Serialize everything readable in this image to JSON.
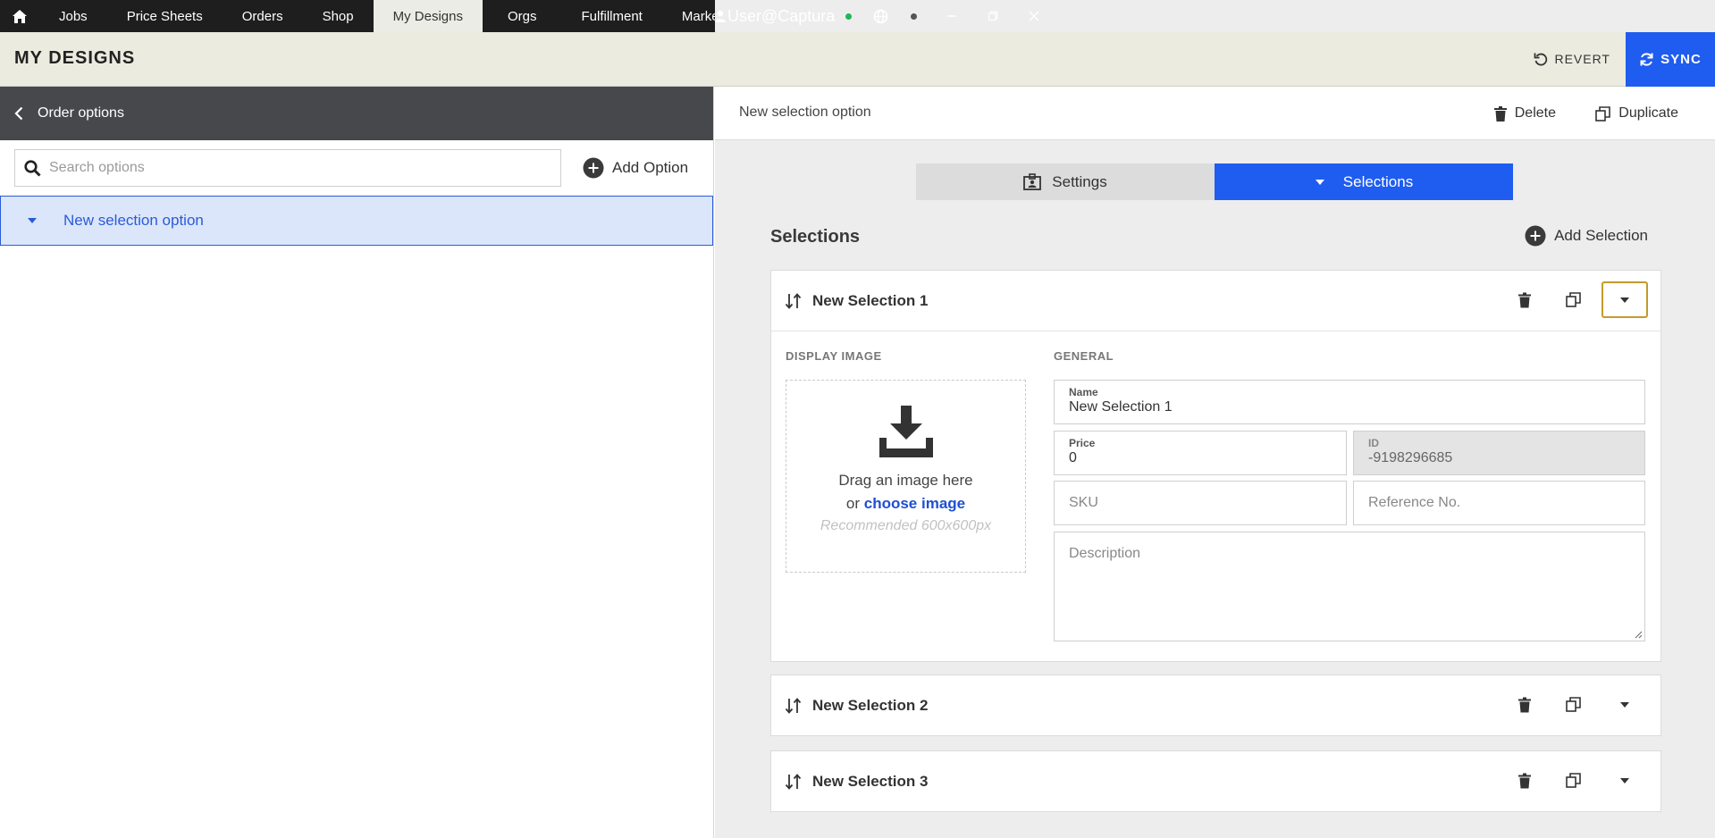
{
  "topnav": {
    "tabs": [
      "Jobs",
      "Price Sheets",
      "Orders",
      "Shop",
      "My Designs",
      "Orgs",
      "Fulfillment",
      "Marketing"
    ],
    "active_tab": "My Designs",
    "user": "User@Captura"
  },
  "header": {
    "title": "MY DESIGNS",
    "revert_label": "REVERT",
    "sync_label": "SYNC"
  },
  "left": {
    "breadcrumb": "Order options",
    "search_placeholder": "Search options",
    "add_option_label": "Add Option",
    "options": [
      {
        "label": "New selection option",
        "selected": true
      }
    ]
  },
  "right": {
    "option_name": "New selection option",
    "delete_label": "Delete",
    "duplicate_label": "Duplicate",
    "tabs": {
      "settings": "Settings",
      "selections": "Selections",
      "active": "Selections"
    },
    "section_title": "Selections",
    "add_selection_label": "Add Selection",
    "display_image_label": "DISPLAY IMAGE",
    "general_label": "GENERAL",
    "drop_text_1": "Drag an image here",
    "drop_text_2_prefix": "or",
    "drop_text_2_link": "choose image",
    "drop_text_3": "Recommended 600x600px",
    "fields": {
      "name_label": "Name",
      "name_value": "New Selection 1",
      "price_label": "Price",
      "price_value": "0",
      "id_label": "ID",
      "id_value": "-9198296685",
      "sku_placeholder": "SKU",
      "reference_placeholder": "Reference No.",
      "description_placeholder": "Description"
    },
    "selections": [
      {
        "name": "New Selection 1",
        "expanded": true
      },
      {
        "name": "New Selection 2",
        "expanded": false
      },
      {
        "name": "New Selection 3",
        "expanded": false
      }
    ]
  },
  "colors": {
    "accent": "#1f5cf0",
    "nav_bg": "#1e1e1e",
    "header_bg": "#ecebe0",
    "selected_option_bg": "#dce6fb",
    "focus_outline": "#c49a2c"
  }
}
